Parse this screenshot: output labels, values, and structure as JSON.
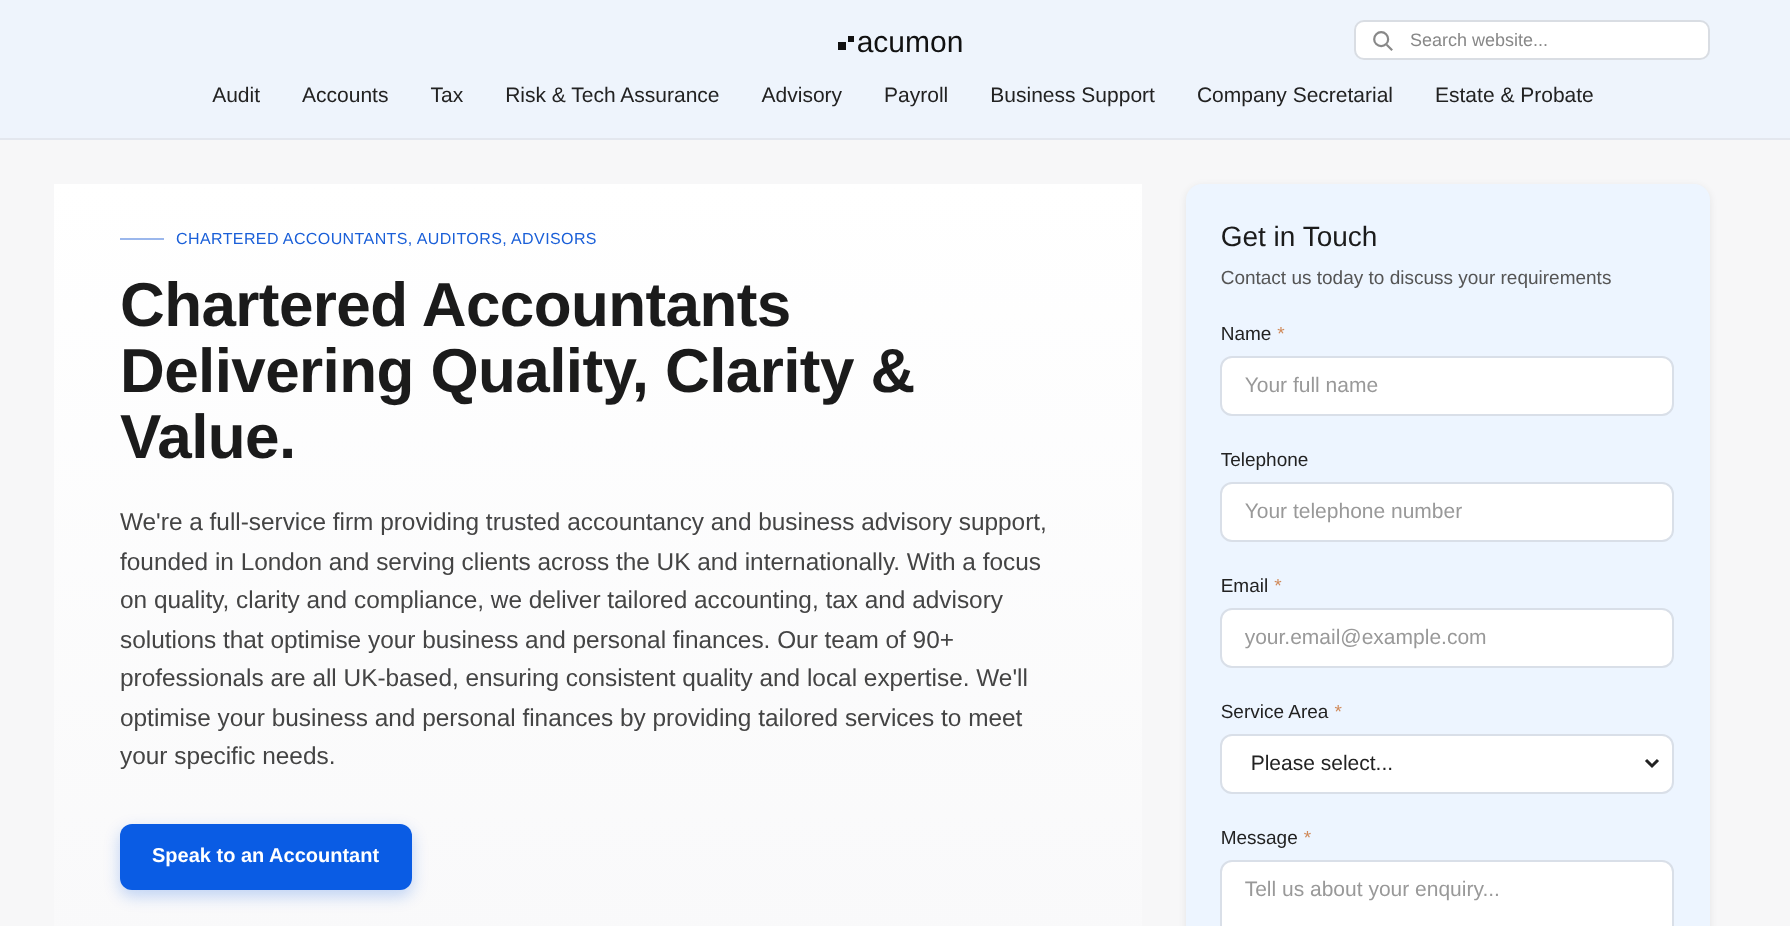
{
  "header": {
    "logo": "acumon",
    "search": {
      "placeholder": "Search website..."
    }
  },
  "nav": [
    "Audit",
    "Accounts",
    "Tax",
    "Risk & Tech Assurance",
    "Advisory",
    "Payroll",
    "Business Support",
    "Company Secretarial",
    "Estate & Probate"
  ],
  "hero": {
    "eyebrow": "CHARTERED ACCOUNTANTS, AUDITORS, ADVISORS",
    "title": "Chartered Accountants Delivering Quality, Clarity & Value.",
    "body": "We're a full-service firm providing trusted accountancy and business advisory support, founded in London and serving clients across the UK and internationally. With a focus on quality, clarity and compliance, we deliver tailored accounting, tax and advisory solutions that optimise your business and personal finances. Our team of 90+ professionals are all UK-based, ensuring consistent quality and local expertise. We'll optimise your business and personal finances by providing tailored services to meet your specific needs.",
    "button": "Speak to an Accountant"
  },
  "contact_form": {
    "title": "Get in Touch",
    "subtitle": "Contact us today to discuss your requirements",
    "fields": [
      {
        "kind": "input",
        "label": "Name",
        "mark": "*",
        "placeholder": "Your full name"
      },
      {
        "kind": "input",
        "label": "Telephone",
        "placeholder": "Your telephone number"
      },
      {
        "kind": "input",
        "label": "Email",
        "mark": "*",
        "placeholder": "your.email@example.com"
      },
      {
        "kind": "select",
        "label": "Service Area",
        "mark": "*",
        "value": "Please select..."
      },
      {
        "kind": "textarea",
        "label": "Message",
        "mark": "*",
        "placeholder": "Tell us about your enquiry..."
      }
    ]
  }
}
